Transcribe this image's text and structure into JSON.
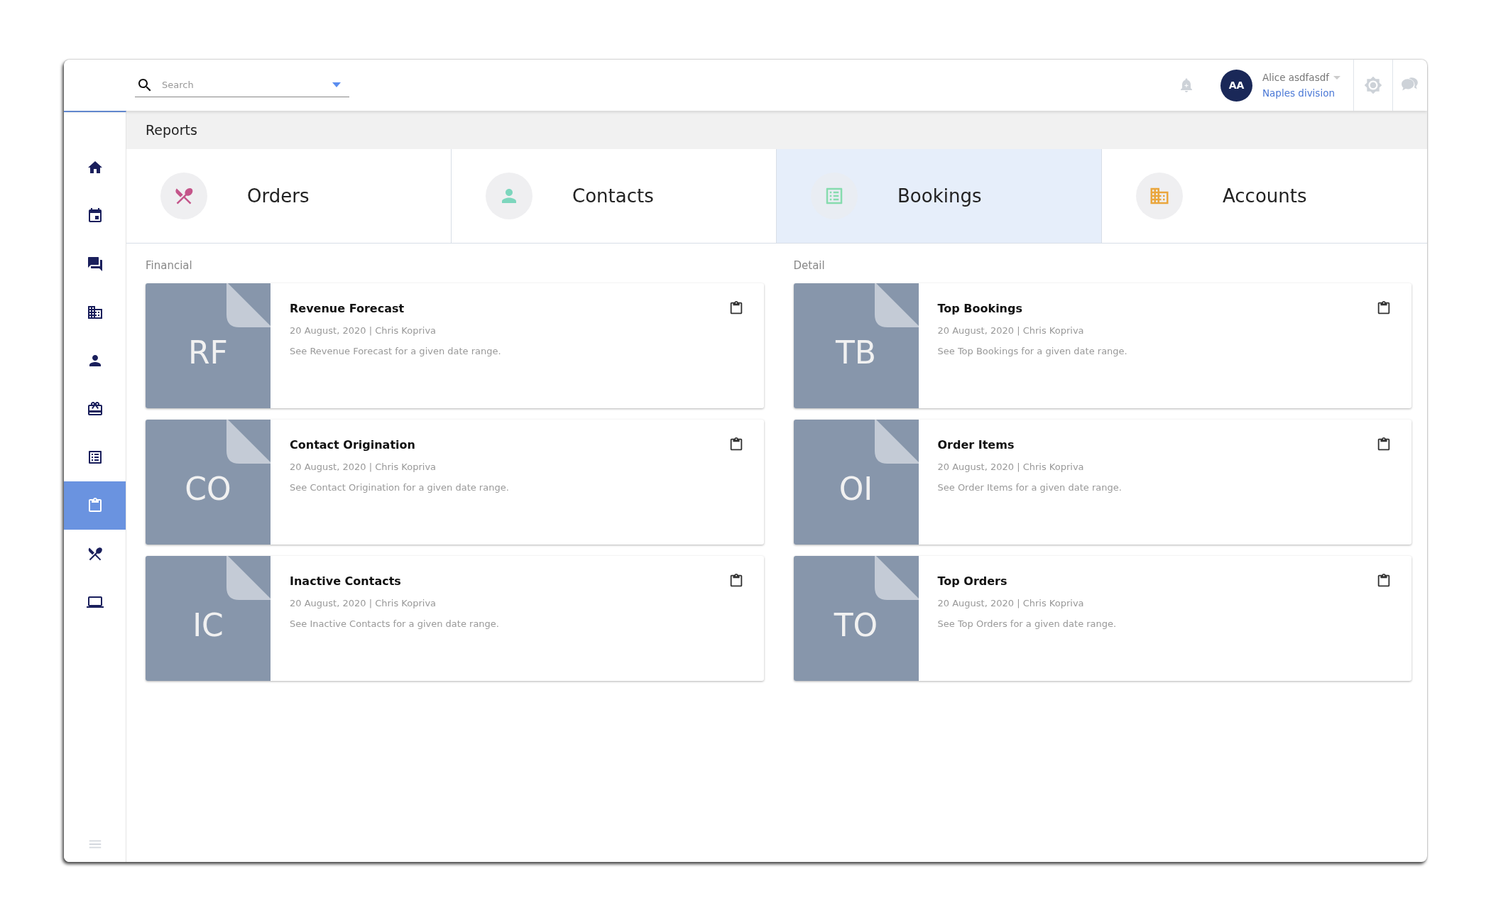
{
  "topbar": {
    "search": {
      "placeholder": "Search"
    },
    "user": {
      "initials": "AA",
      "name": "Alice asdfasdf",
      "division": "Naples division"
    }
  },
  "sidebar": {
    "items": [
      {
        "selected": false
      },
      {
        "selected": false
      },
      {
        "selected": false
      },
      {
        "selected": false
      },
      {
        "selected": false
      },
      {
        "selected": false
      },
      {
        "selected": false
      },
      {
        "selected": true
      },
      {
        "selected": false
      },
      {
        "selected": false
      }
    ]
  },
  "page_title": "Reports",
  "tabs": [
    {
      "label": "Orders",
      "selected": false
    },
    {
      "label": "Contacts",
      "selected": false
    },
    {
      "label": "Bookings",
      "selected": true
    },
    {
      "label": "Accounts",
      "selected": false
    }
  ],
  "sections": [
    {
      "title": "Financial",
      "cards": [
        {
          "initials": "RF",
          "title": "Revenue Forecast",
          "meta": "20 August, 2020 | Chris Kopriva",
          "description": "See Revenue Forecast for a given date range."
        },
        {
          "initials": "CO",
          "title": "Contact Origination",
          "meta": "20 August, 2020 | Chris Kopriva",
          "description": "See Contact Origination for a given date range."
        },
        {
          "initials": "IC",
          "title": "Inactive Contacts",
          "meta": "20 August, 2020 | Chris Kopriva",
          "description": "See Inactive Contacts for a given date range."
        }
      ]
    },
    {
      "title": "Detail",
      "cards": [
        {
          "initials": "TB",
          "title": "Top Bookings",
          "meta": "20 August, 2020 | Chris Kopriva",
          "description": "See Top Bookings for a given date range."
        },
        {
          "initials": "OI",
          "title": "Order Items",
          "meta": "20 August, 2020 | Chris Kopriva",
          "description": "See Order Items for a given date range."
        },
        {
          "initials": "TO",
          "title": "Top Orders",
          "meta": "20 August, 2020 | Chris Kopriva",
          "description": "See Top Orders for a given date range."
        }
      ]
    }
  ]
}
